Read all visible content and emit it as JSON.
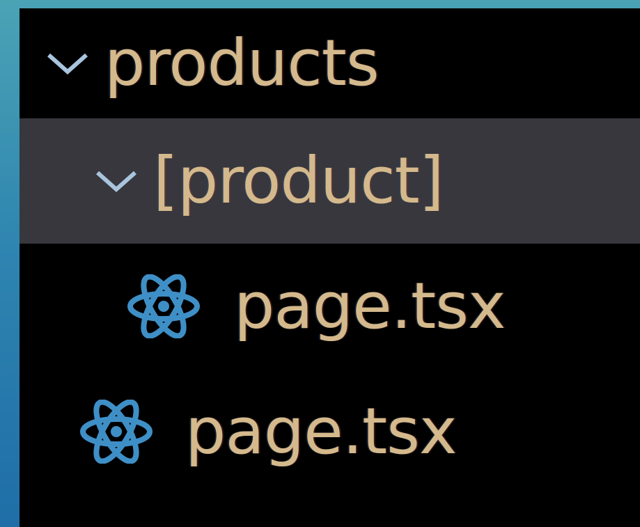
{
  "explorer": {
    "items": [
      {
        "label": "products",
        "kind": "folder",
        "expanded": true,
        "selected": false,
        "icon": "chevron-down-icon"
      },
      {
        "label": "[product]",
        "kind": "folder",
        "expanded": true,
        "selected": true,
        "icon": "chevron-down-icon"
      },
      {
        "label": "page.tsx",
        "kind": "file",
        "selected": false,
        "icon": "react-icon"
      },
      {
        "label": "page.tsx",
        "kind": "file",
        "selected": false,
        "icon": "react-icon"
      }
    ]
  },
  "colors": {
    "background": "#000000",
    "selected_row": "#37373d",
    "label_text": "#d4b98c",
    "chevron": "#a9c4dc",
    "react_icon": "#3f8fc7",
    "window_edge": "#2f86b0"
  }
}
